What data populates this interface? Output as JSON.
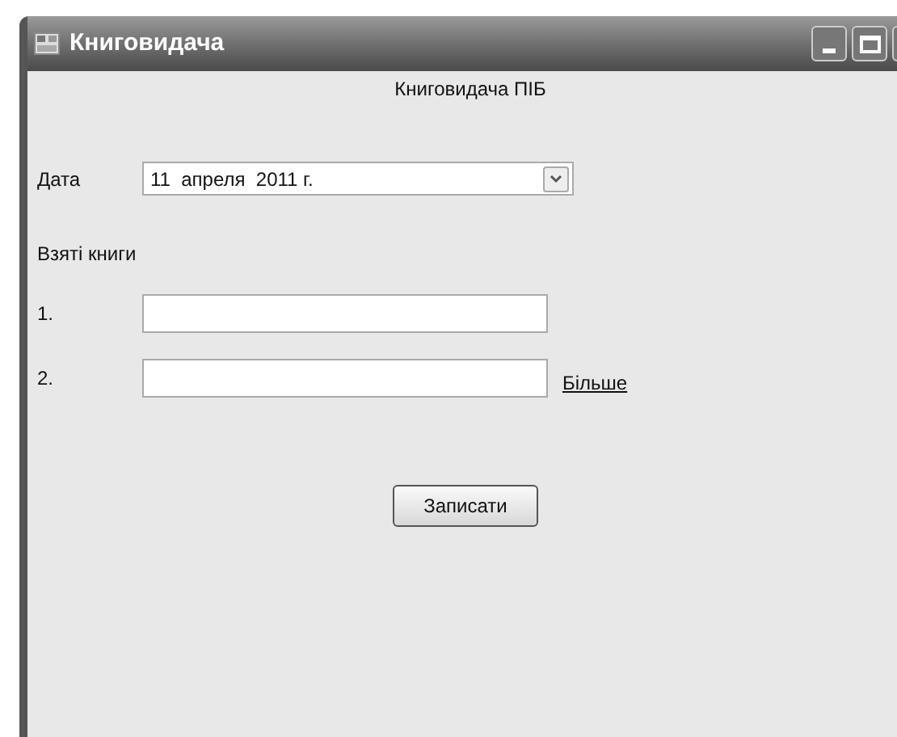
{
  "window": {
    "title": "Книговидача"
  },
  "heading": "Книговидача ПІБ",
  "date": {
    "label": "Дата",
    "value": "11  апреля  2011 г."
  },
  "books": {
    "label": "Взяті книги",
    "rows": [
      {
        "number": "1."
      },
      {
        "number": "2.",
        "link": "Більше"
      }
    ]
  },
  "buttons": [
    "Записати"
  ]
}
